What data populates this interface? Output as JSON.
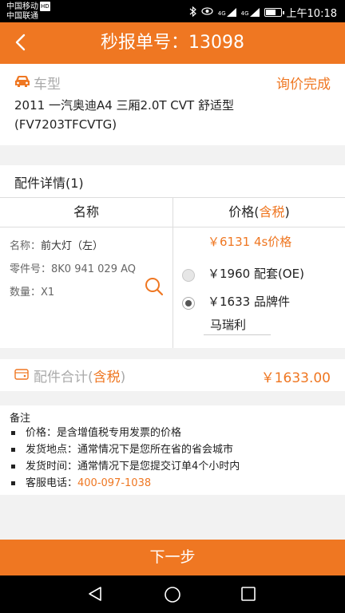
{
  "status_bar": {
    "carrier1": "中国移动",
    "carrier1_badge": "HD",
    "carrier2": "中国联通",
    "signal1": "4G",
    "signal2": "4G",
    "time": "上午10:18"
  },
  "header": {
    "back_icon": "chevron-left-icon",
    "title": "秒报单号：13098"
  },
  "vehicle": {
    "icon": "car-icon",
    "label": "车型",
    "status": "询价完成",
    "model_line1": "2011 一汽奥迪A4 三厢2.0T CVT 舒适型",
    "model_line2": "(FV7203TFCVTG)"
  },
  "parts": {
    "title": "配件详情(1)",
    "col_name": "名称",
    "col_price_prefix": "价格(",
    "col_price_tax": "含税",
    "col_price_suffix": ")",
    "name_key": "名称：",
    "name_value": "前大灯（左）",
    "partno_key": "零件号：",
    "partno_value": "8K0 941 029 AQ",
    "qty_key": "数量：",
    "qty_value": "X1",
    "main_price": "￥6131 4s价格",
    "options": [
      {
        "label": "￥1960 配套(OE)",
        "selected": false
      },
      {
        "label": "￥1633 品牌件",
        "selected": true
      }
    ],
    "brand": "马瑞利"
  },
  "total": {
    "label_prefix": "配件合计(",
    "label_tax": "含税",
    "label_suffix": ")",
    "amount": "￥1633.00"
  },
  "notes": {
    "title": "备注",
    "items": [
      {
        "text": "价格：是含增值税专用发票的价格"
      },
      {
        "text": "发货地点：通常情况下是您所在省的省会城市"
      },
      {
        "text": "发货时间：通常情况下是您提交订单4个小时内"
      },
      {
        "prefix": "客服电话：",
        "phone": "400-097-1038"
      }
    ]
  },
  "next_button": "下一步",
  "colors": {
    "accent": "#ef7722",
    "background": "#f2f2f2"
  }
}
